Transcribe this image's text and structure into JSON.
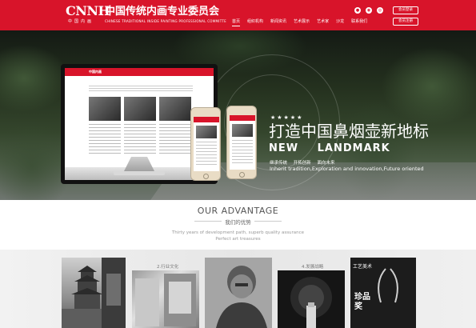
{
  "header": {
    "logo_en": "CNNH",
    "logo_cn_small": "中国内画",
    "org_name": "中国传统内画专业委员会",
    "org_name_en": "CHINESE TRADITIONAL INSIDE PAINTING PROFESSIONAL COMMITTE",
    "nav": [
      "首页",
      "组织机构",
      "新闻资讯",
      "艺术展示",
      "艺术家",
      "沙龙",
      "联系我们"
    ],
    "icons": [
      "user-icon",
      "weibo-icon",
      "wechat-icon"
    ],
    "login_label": "会员登录",
    "register_label": "会员注册",
    "brand_color": "#d8142a"
  },
  "hero": {
    "stars": "★★★★★",
    "slogan": "打造中国鼻烟壶新地标",
    "slogan_en": "NEW LANDMARK",
    "tags": "继承传统 开拓创新 面向未来",
    "tagline_en": "Inherit tradition,Exploration and innovation,Future oriented",
    "mock_site_logo": "中国内画"
  },
  "advantage": {
    "title": "OUR ADVANTAGE",
    "subtitle": "我们的优势",
    "desc1": "Thirty years of development path, superb quality assurance",
    "desc2": "Perfect art treasures",
    "cards": [
      {
        "label": ""
      },
      {
        "label": "2.行业文化"
      },
      {
        "label": ""
      },
      {
        "label": "4.发展战略"
      },
      {
        "label": "工艺美术",
        "extra": "珍品奖"
      }
    ]
  }
}
